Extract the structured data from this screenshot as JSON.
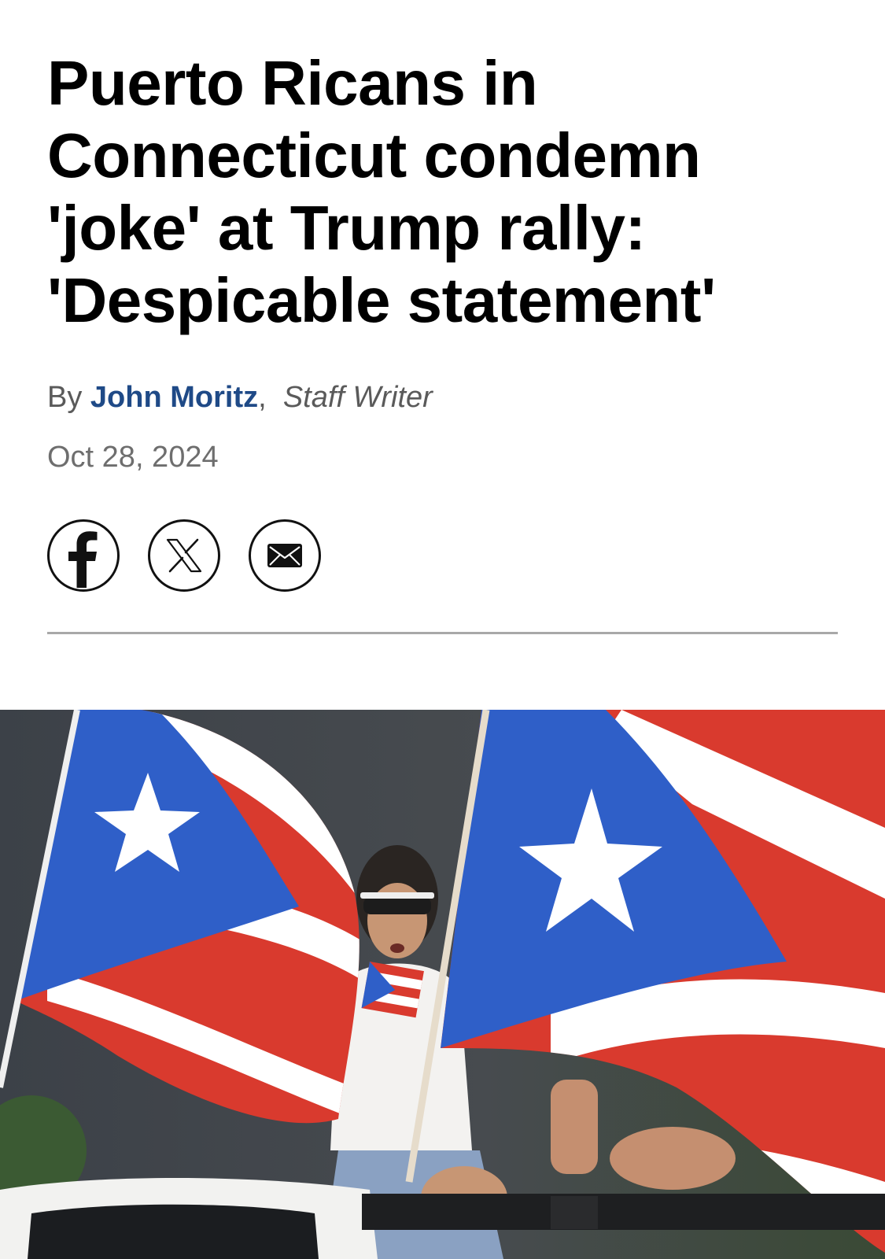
{
  "article": {
    "headline": "Puerto Ricans in Connecticut condemn 'joke' at Trump rally: 'Despicable statement'",
    "byline": {
      "prefix": "By",
      "author": "John Moritz",
      "separator": ",",
      "role": "Staff Writer"
    },
    "date": "Oct 28, 2024"
  },
  "share": {
    "buttons": [
      {
        "icon": "facebook-icon"
      },
      {
        "icon": "x-icon"
      },
      {
        "icon": "email-icon"
      }
    ]
  },
  "hero_image": {
    "subject": "puerto-rico-flags-photo"
  },
  "colors": {
    "headline": "#000000",
    "author_link": "#1f4a87",
    "meta_gray": "#6e6e6e",
    "divider": "#a8a8a8",
    "flag_blue": "#2f5fc8",
    "flag_red": "#d93a2e"
  }
}
